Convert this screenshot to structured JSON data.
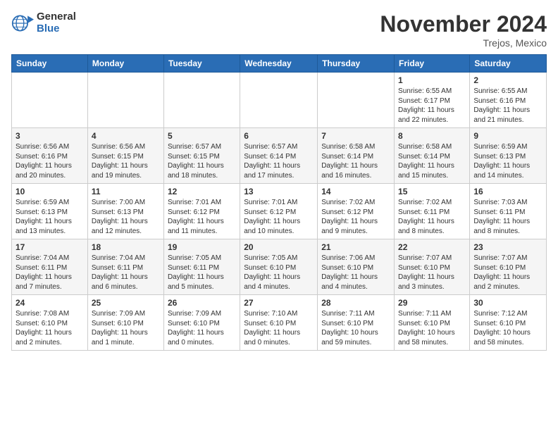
{
  "header": {
    "logo_general": "General",
    "logo_blue": "Blue",
    "month": "November 2024",
    "location": "Trejos, Mexico"
  },
  "days_of_week": [
    "Sunday",
    "Monday",
    "Tuesday",
    "Wednesday",
    "Thursday",
    "Friday",
    "Saturday"
  ],
  "weeks": [
    [
      {
        "day": "",
        "info": ""
      },
      {
        "day": "",
        "info": ""
      },
      {
        "day": "",
        "info": ""
      },
      {
        "day": "",
        "info": ""
      },
      {
        "day": "",
        "info": ""
      },
      {
        "day": "1",
        "info": "Sunrise: 6:55 AM\nSunset: 6:17 PM\nDaylight: 11 hours\nand 22 minutes."
      },
      {
        "day": "2",
        "info": "Sunrise: 6:55 AM\nSunset: 6:16 PM\nDaylight: 11 hours\nand 21 minutes."
      }
    ],
    [
      {
        "day": "3",
        "info": "Sunrise: 6:56 AM\nSunset: 6:16 PM\nDaylight: 11 hours\nand 20 minutes."
      },
      {
        "day": "4",
        "info": "Sunrise: 6:56 AM\nSunset: 6:15 PM\nDaylight: 11 hours\nand 19 minutes."
      },
      {
        "day": "5",
        "info": "Sunrise: 6:57 AM\nSunset: 6:15 PM\nDaylight: 11 hours\nand 18 minutes."
      },
      {
        "day": "6",
        "info": "Sunrise: 6:57 AM\nSunset: 6:14 PM\nDaylight: 11 hours\nand 17 minutes."
      },
      {
        "day": "7",
        "info": "Sunrise: 6:58 AM\nSunset: 6:14 PM\nDaylight: 11 hours\nand 16 minutes."
      },
      {
        "day": "8",
        "info": "Sunrise: 6:58 AM\nSunset: 6:14 PM\nDaylight: 11 hours\nand 15 minutes."
      },
      {
        "day": "9",
        "info": "Sunrise: 6:59 AM\nSunset: 6:13 PM\nDaylight: 11 hours\nand 14 minutes."
      }
    ],
    [
      {
        "day": "10",
        "info": "Sunrise: 6:59 AM\nSunset: 6:13 PM\nDaylight: 11 hours\nand 13 minutes."
      },
      {
        "day": "11",
        "info": "Sunrise: 7:00 AM\nSunset: 6:13 PM\nDaylight: 11 hours\nand 12 minutes."
      },
      {
        "day": "12",
        "info": "Sunrise: 7:01 AM\nSunset: 6:12 PM\nDaylight: 11 hours\nand 11 minutes."
      },
      {
        "day": "13",
        "info": "Sunrise: 7:01 AM\nSunset: 6:12 PM\nDaylight: 11 hours\nand 10 minutes."
      },
      {
        "day": "14",
        "info": "Sunrise: 7:02 AM\nSunset: 6:12 PM\nDaylight: 11 hours\nand 9 minutes."
      },
      {
        "day": "15",
        "info": "Sunrise: 7:02 AM\nSunset: 6:11 PM\nDaylight: 11 hours\nand 8 minutes."
      },
      {
        "day": "16",
        "info": "Sunrise: 7:03 AM\nSunset: 6:11 PM\nDaylight: 11 hours\nand 8 minutes."
      }
    ],
    [
      {
        "day": "17",
        "info": "Sunrise: 7:04 AM\nSunset: 6:11 PM\nDaylight: 11 hours\nand 7 minutes."
      },
      {
        "day": "18",
        "info": "Sunrise: 7:04 AM\nSunset: 6:11 PM\nDaylight: 11 hours\nand 6 minutes."
      },
      {
        "day": "19",
        "info": "Sunrise: 7:05 AM\nSunset: 6:11 PM\nDaylight: 11 hours\nand 5 minutes."
      },
      {
        "day": "20",
        "info": "Sunrise: 7:05 AM\nSunset: 6:10 PM\nDaylight: 11 hours\nand 4 minutes."
      },
      {
        "day": "21",
        "info": "Sunrise: 7:06 AM\nSunset: 6:10 PM\nDaylight: 11 hours\nand 4 minutes."
      },
      {
        "day": "22",
        "info": "Sunrise: 7:07 AM\nSunset: 6:10 PM\nDaylight: 11 hours\nand 3 minutes."
      },
      {
        "day": "23",
        "info": "Sunrise: 7:07 AM\nSunset: 6:10 PM\nDaylight: 11 hours\nand 2 minutes."
      }
    ],
    [
      {
        "day": "24",
        "info": "Sunrise: 7:08 AM\nSunset: 6:10 PM\nDaylight: 11 hours\nand 2 minutes."
      },
      {
        "day": "25",
        "info": "Sunrise: 7:09 AM\nSunset: 6:10 PM\nDaylight: 11 hours\nand 1 minute."
      },
      {
        "day": "26",
        "info": "Sunrise: 7:09 AM\nSunset: 6:10 PM\nDaylight: 11 hours\nand 0 minutes."
      },
      {
        "day": "27",
        "info": "Sunrise: 7:10 AM\nSunset: 6:10 PM\nDaylight: 11 hours\nand 0 minutes."
      },
      {
        "day": "28",
        "info": "Sunrise: 7:11 AM\nSunset: 6:10 PM\nDaylight: 10 hours\nand 59 minutes."
      },
      {
        "day": "29",
        "info": "Sunrise: 7:11 AM\nSunset: 6:10 PM\nDaylight: 10 hours\nand 58 minutes."
      },
      {
        "day": "30",
        "info": "Sunrise: 7:12 AM\nSunset: 6:10 PM\nDaylight: 10 hours\nand 58 minutes."
      }
    ]
  ]
}
